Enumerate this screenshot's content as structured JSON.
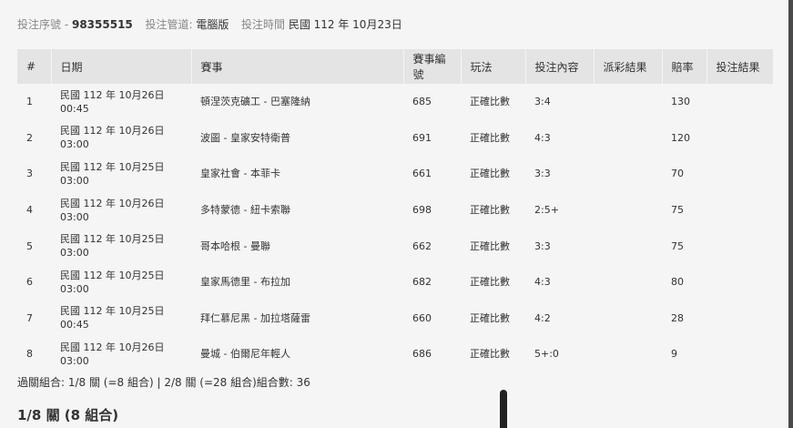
{
  "info": {
    "serial_label": "投注序號 -",
    "serial_value": "98355515",
    "channel_label": "投注管道:",
    "channel_value": "電腦版",
    "time_label": "投注時間",
    "time_value": "民國 112 年 10月23日"
  },
  "table": {
    "headers": [
      "#",
      "日期",
      "賽事",
      "賽事編號",
      "玩法",
      "投注內容",
      "派彩結果",
      "賠率",
      "投注結果"
    ],
    "rows": [
      {
        "no": "1",
        "date1": "民國 112 年 10月26日",
        "date2": "00:45",
        "match": "頓涅茨克礦工 - 巴塞隆納",
        "code": "685",
        "type": "正確比數",
        "pick": "3:4",
        "payout": "",
        "odds": "130",
        "result": ""
      },
      {
        "no": "2",
        "date1": "民國 112 年 10月26日",
        "date2": "03:00",
        "match": "波圖 - 皇家安特衛普",
        "code": "691",
        "type": "正確比數",
        "pick": "4:3",
        "payout": "",
        "odds": "120",
        "result": ""
      },
      {
        "no": "3",
        "date1": "民國 112 年 10月25日",
        "date2": "03:00",
        "match": "皇家社會 - 本菲卡",
        "code": "661",
        "type": "正確比數",
        "pick": "3:3",
        "payout": "",
        "odds": "70",
        "result": ""
      },
      {
        "no": "4",
        "date1": "民國 112 年 10月26日",
        "date2": "03:00",
        "match": "多特蒙德 - 紐卡索聯",
        "code": "698",
        "type": "正確比數",
        "pick": "2:5+",
        "payout": "",
        "odds": "75",
        "result": ""
      },
      {
        "no": "5",
        "date1": "民國 112 年 10月25日",
        "date2": "03:00",
        "match": "哥本哈根 - 曼聯",
        "code": "662",
        "type": "正確比數",
        "pick": "3:3",
        "payout": "",
        "odds": "75",
        "result": ""
      },
      {
        "no": "6",
        "date1": "民國 112 年 10月25日",
        "date2": "03:00",
        "match": "皇家馬德里 - 布拉加",
        "code": "682",
        "type": "正確比數",
        "pick": "4:3",
        "payout": "",
        "odds": "80",
        "result": ""
      },
      {
        "no": "7",
        "date1": "民國 112 年 10月25日",
        "date2": "00:45",
        "match": "拜仁慕尼黑 - 加拉塔薩雷",
        "code": "660",
        "type": "正確比數",
        "pick": "4:2",
        "payout": "",
        "odds": "28",
        "result": ""
      },
      {
        "no": "8",
        "date1": "民國 112 年 10月26日",
        "date2": "03:00",
        "match": "曼城 - 伯爾尼年輕人",
        "code": "686",
        "type": "正確比數",
        "pick": "5+:0",
        "payout": "",
        "odds": "9",
        "result": ""
      }
    ]
  },
  "summary": "過關組合: 1/8 關 (=8 組合) | 2/8 關 (=28 組合)組合數: 36",
  "section_title": "1/8 關 (8 組合)"
}
